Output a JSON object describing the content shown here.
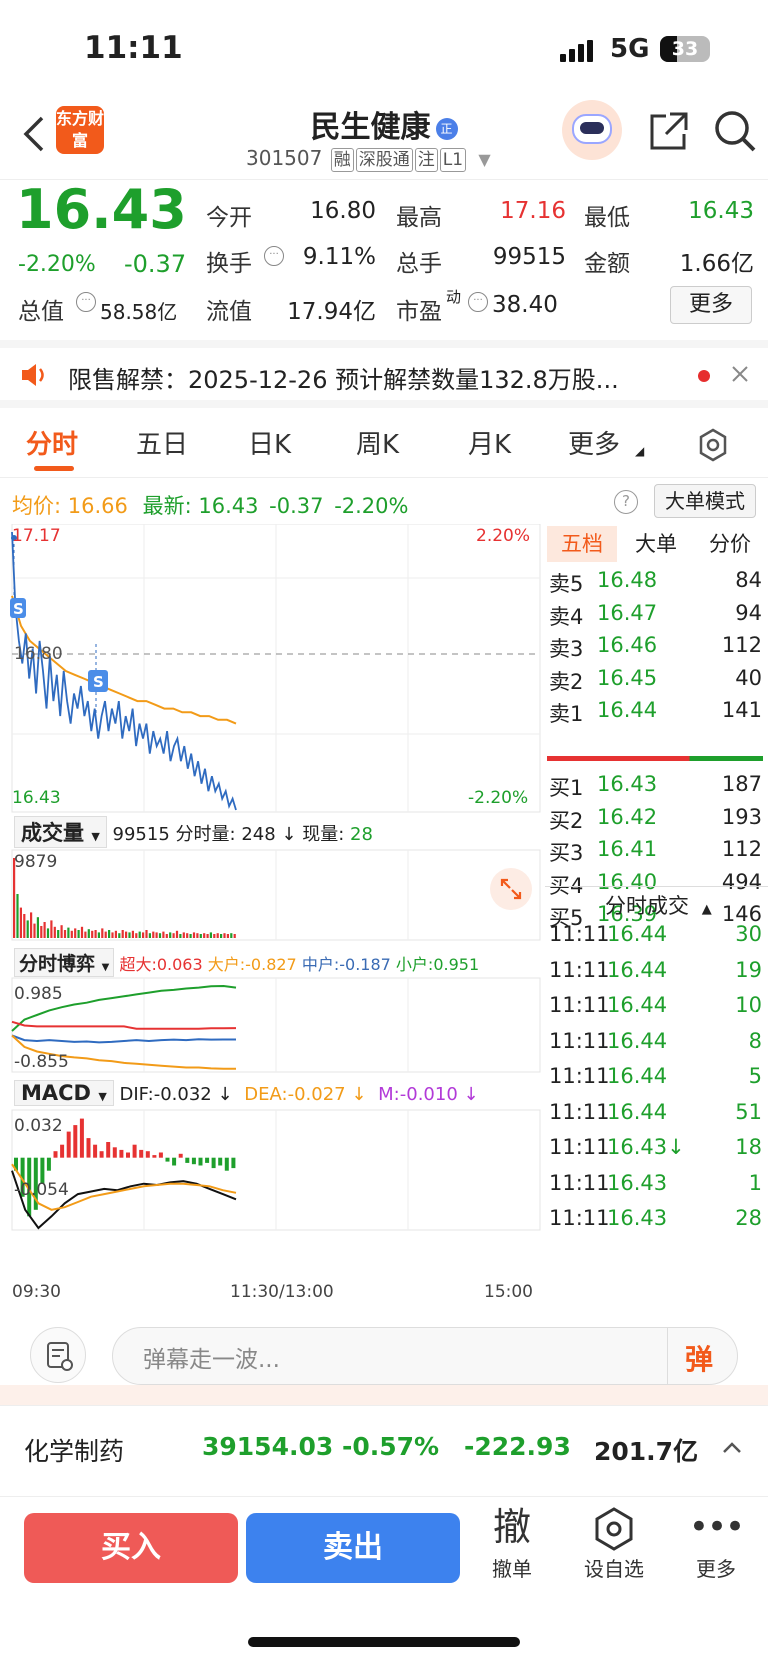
{
  "status": {
    "time": "11:11",
    "network": "5G",
    "battery": "33"
  },
  "header": {
    "name": "民生健康",
    "code": "301507",
    "tags": [
      "融",
      "深股通",
      "注",
      "L1"
    ],
    "logo": "东方财富"
  },
  "quote": {
    "price": "16.43",
    "pct": "-2.20%",
    "chg": "-0.37",
    "open_label": "今开",
    "open": "16.80",
    "high_label": "最高",
    "high": "17.16",
    "low_label": "最低",
    "low": "16.43",
    "turnover_label": "换手",
    "turnover": "9.11%",
    "volume_label": "总手",
    "volume": "99515",
    "amount_label": "金额",
    "amount": "1.66亿",
    "mcap_label": "总值",
    "mcap": "58.58亿",
    "float_label": "流值",
    "float": "17.94亿",
    "pe_label": "市盈",
    "pe_sup": "动",
    "pe": "38.40",
    "more": "更多"
  },
  "notice": {
    "text": "限售解禁：2025-12-26 预计解禁数量132.8万股..."
  },
  "tabs": [
    "分时",
    "五日",
    "日K",
    "周K",
    "月K",
    "更多"
  ],
  "avgline": {
    "avg_label": "均价:",
    "avg": "16.66",
    "last_label": "最新:",
    "last": "16.43",
    "chg": "-0.37",
    "pct": "-2.20%",
    "mode_btn": "大单模式"
  },
  "chart": {
    "ytop": "17.17",
    "ybottom": "16.43",
    "ymid": "16.80",
    "pct_top": "2.20%",
    "pct_bottom": "-2.20%",
    "vol_label": "成交量",
    "vol_total": "99515",
    "vol_tick_label": "分时量:",
    "vol_tick": "248",
    "vol_now_label": "现量:",
    "vol_now": "28",
    "vol_max": "9879",
    "game_label": "分时博弈",
    "super_label": "超大:",
    "super": "0.063",
    "big_label": "大户:",
    "big": "-0.827",
    "mid_label": "中户:",
    "mid": "-0.187",
    "small_label": "小户:",
    "small": "0.951",
    "game_top": "0.985",
    "game_bottom": "-0.855",
    "macd_label": "MACD",
    "dif_label": "DIF:",
    "dif": "-0.032",
    "dea_label": "DEA:",
    "dea": "-0.027",
    "m_label": "M:",
    "m": "-0.010",
    "macd_top": "0.032",
    "macd_bottom": "-0.054",
    "x_start": "09:30",
    "x_mid": "11:30/13:00",
    "x_end": "15:00",
    "colors": {
      "price": "#2f6bc0",
      "avg": "#f29b18",
      "up": "#e63232",
      "down": "#1e9f2c"
    }
  },
  "orderbook": {
    "tabs": [
      "五档",
      "大单",
      "分价"
    ],
    "sells": [
      {
        "label": "卖5",
        "price": "16.48",
        "vol": "84"
      },
      {
        "label": "卖4",
        "price": "16.47",
        "vol": "94"
      },
      {
        "label": "卖3",
        "price": "16.46",
        "vol": "112"
      },
      {
        "label": "卖2",
        "price": "16.45",
        "vol": "40"
      },
      {
        "label": "卖1",
        "price": "16.44",
        "vol": "141"
      }
    ],
    "buys": [
      {
        "label": "买1",
        "price": "16.43",
        "vol": "187"
      },
      {
        "label": "买2",
        "price": "16.42",
        "vol": "193"
      },
      {
        "label": "买3",
        "price": "16.41",
        "vol": "112"
      },
      {
        "label": "买4",
        "price": "16.40",
        "vol": "494"
      },
      {
        "label": "买5",
        "price": "16.39",
        "vol": "146"
      }
    ],
    "trades_title": "分时成交",
    "trades": [
      {
        "time": "11:11",
        "price": "16.44",
        "vol": "30"
      },
      {
        "time": "11:11",
        "price": "16.44",
        "vol": "19"
      },
      {
        "time": "11:11",
        "price": "16.44",
        "vol": "10"
      },
      {
        "time": "11:11",
        "price": "16.44",
        "vol": "8"
      },
      {
        "time": "11:11",
        "price": "16.44",
        "vol": "5"
      },
      {
        "time": "11:11",
        "price": "16.44",
        "vol": "51"
      },
      {
        "time": "11:11",
        "price": "16.43↓",
        "vol": "18"
      },
      {
        "time": "11:11",
        "price": "16.43",
        "vol": "1"
      },
      {
        "time": "11:11",
        "price": "16.43",
        "vol": "28"
      }
    ]
  },
  "danmu": {
    "placeholder": "弹幕走一波...",
    "btn": "弹"
  },
  "sector": {
    "name": "化学制药",
    "index": "39154.03",
    "pct": "-0.57%",
    "chg": "-222.93",
    "amount": "201.7亿"
  },
  "bottom": {
    "buy": "买入",
    "sell": "卖出",
    "cancel_icon": "撤",
    "cancel": "撤单",
    "watch": "设自选",
    "more": "更多"
  }
}
